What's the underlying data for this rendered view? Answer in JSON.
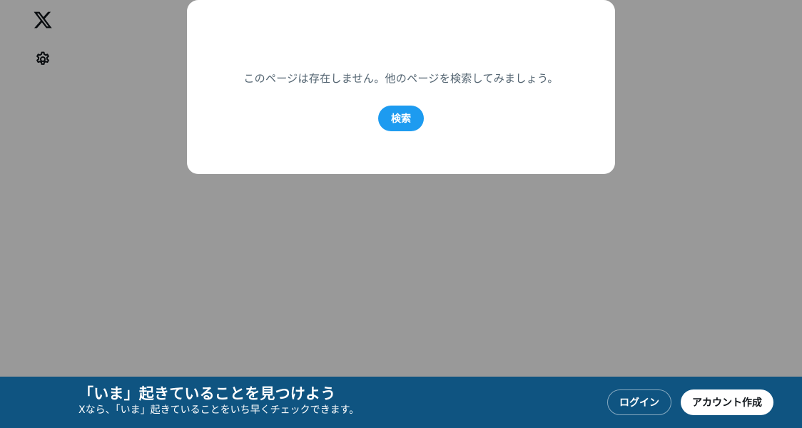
{
  "sidebar": {
    "logo_icon": "x-logo-icon",
    "settings_icon": "gear-icon"
  },
  "modal": {
    "message": "このページは存在しません。他のページを検索してみましょう。",
    "search_button_label": "検索"
  },
  "bottom_bar": {
    "title": "「いま」起きていることを見つけよう",
    "subtitle": "Xなら、「いま」起きていることをいち早くチェックできます。",
    "login_label": "ログイン",
    "signup_label": "アカウント作成"
  },
  "colors": {
    "accent": "#1d9bf0",
    "bottom_bar_bg": "#1a8cd8",
    "overlay": "rgba(0,0,0,0.4)",
    "message_text": "#536471"
  }
}
